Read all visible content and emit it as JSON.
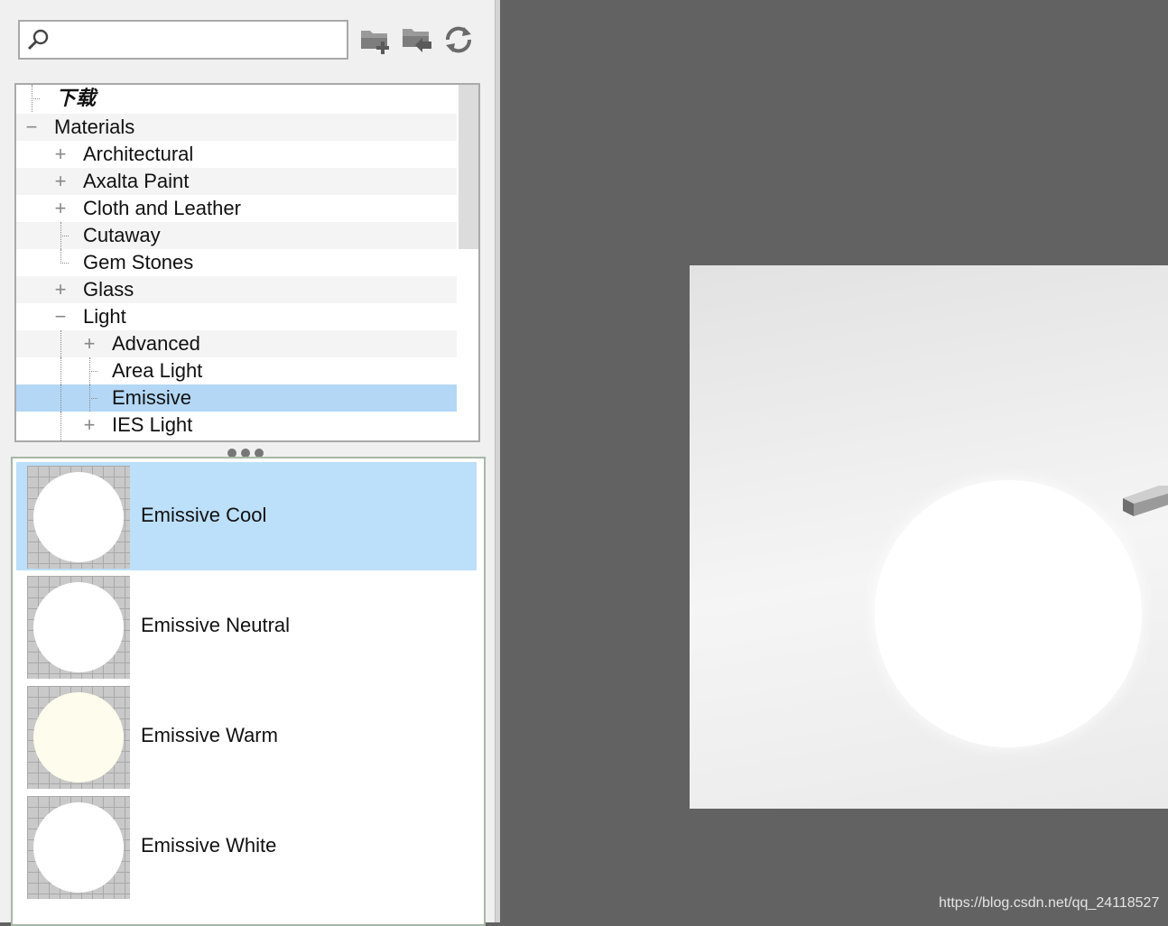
{
  "search": {
    "placeholder": "",
    "value": ""
  },
  "toolbar": {
    "add_folder_icon": "folder-add-icon",
    "import_folder_icon": "folder-import-icon",
    "refresh_icon": "refresh-icon"
  },
  "tree": {
    "download_label": "下载",
    "materials_label": "Materials",
    "architectural_label": "Architectural",
    "axalta_label": "Axalta Paint",
    "cloth_label": "Cloth and Leather",
    "cutaway_label": "Cutaway",
    "gemstones_label": "Gem Stones",
    "glass_label": "Glass",
    "light_label": "Light",
    "advanced_label": "Advanced",
    "arealight_label": "Area Light",
    "emissive_label": "Emissive",
    "ieslight_label": "IES Light",
    "expand_glyph": "+",
    "collapse_glyph": "−"
  },
  "materials": {
    "items": [
      {
        "label": "Emissive Cool",
        "ball_color": "#ffffff",
        "selected": true
      },
      {
        "label": "Emissive Neutral",
        "ball_color": "#ffffff",
        "selected": false
      },
      {
        "label": "Emissive Warm",
        "ball_color": "#fefcec",
        "selected": false
      },
      {
        "label": "Emissive White",
        "ball_color": "#ffffff",
        "selected": false
      }
    ]
  },
  "colors": {
    "selection": "#b3d7f5",
    "viewport_bg": "#626262"
  },
  "watermark": "https://blog.csdn.net/qq_24118527"
}
